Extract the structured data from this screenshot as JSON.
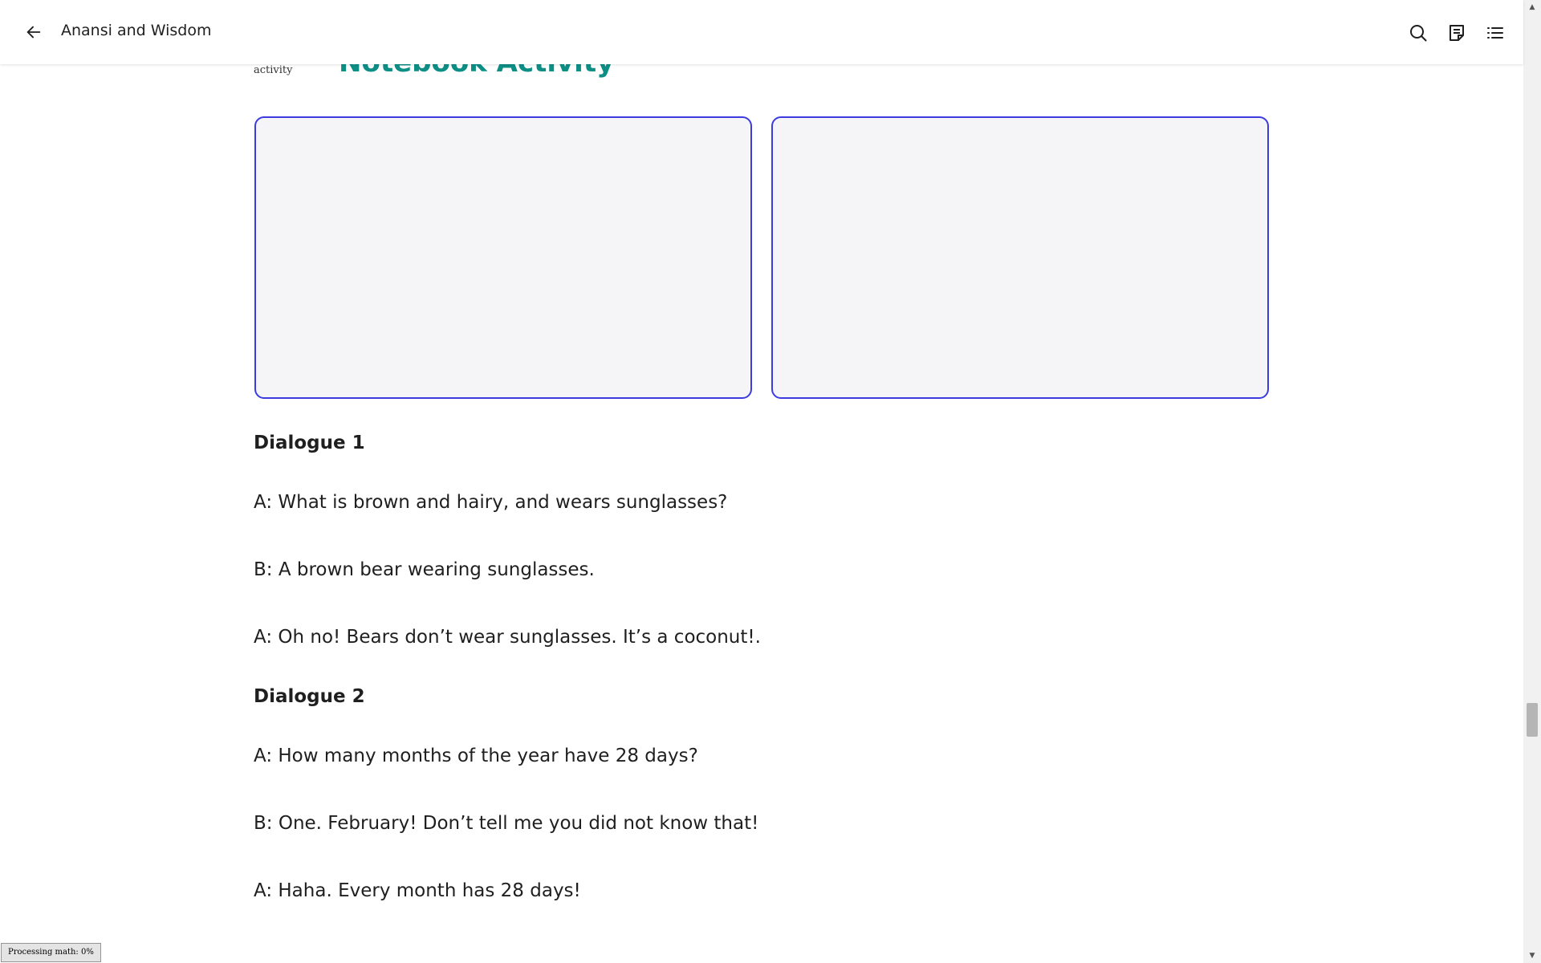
{
  "header": {
    "back_icon": "arrow-left-icon",
    "title": "Anansi and Wisdom",
    "icons": [
      "search-icon",
      "notes-icon",
      "table-of-contents-icon"
    ]
  },
  "section": {
    "activity_label": "activity",
    "heading": "Notebook Activity"
  },
  "notebook_boxes": [
    {
      "value": ""
    },
    {
      "value": ""
    }
  ],
  "dialogue1": {
    "heading": "Dialogue 1",
    "lines": [
      "A: What is brown and hairy, and wears sunglasses?",
      "B: A brown bear wearing sunglasses.",
      "A: Oh no! Bears don’t wear sunglasses. It’s a coconut!."
    ]
  },
  "dialogue2": {
    "heading": "Dialogue 2",
    "lines": [
      "A: How many months of the year have 28 days?",
      "B: One. February! Don’t tell me you did not know that!",
      "A: Haha. Every month has 28 days!"
    ]
  },
  "status": {
    "text": "Processing math: 0%"
  },
  "colors": {
    "heading_teal": "#0d8f86",
    "box_border": "#3b3be0",
    "box_fill": "#f5f5f8"
  }
}
